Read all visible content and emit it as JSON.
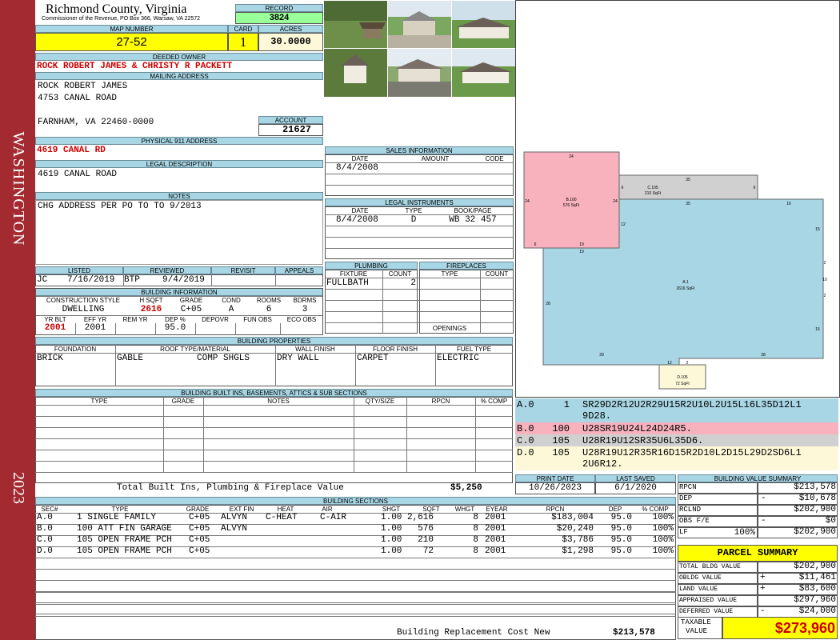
{
  "sidebar": {
    "label": "WASHINGTON",
    "year": "2023"
  },
  "header": {
    "county": "Richmond County, Virginia",
    "commissioner": "Commissioner of the Revenue, PO Box 366, Warsaw, VA 22572",
    "record_label": "RECORD",
    "record": "3824",
    "map_label": "MAP NUMBER",
    "map": "27-52",
    "card_label": "CARD",
    "card": "1",
    "acres_label": "ACRES",
    "acres": "30.0000"
  },
  "owner": {
    "deeded_label": "DEEDED OWNER",
    "deeded": "ROCK ROBERT JAMES & CHRISTY R PACKETT",
    "mailing_label": "MAILING ADDRESS",
    "mail1": "ROCK ROBERT JAMES",
    "mail2": "4753 CANAL ROAD",
    "mail3": "FARNHAM, VA 22460-0000",
    "account_label": "ACCOUNT",
    "account": "21627",
    "phys_label": "PHYSICAL 911 ADDRESS",
    "phys": "4619 CANAL RD",
    "legal_label": "LEGAL DESCRIPTION",
    "legal": "4619 CANAL ROAD",
    "notes_label": "NOTES",
    "notes": "CHG ADDRESS PER PO TO TO 9/2013"
  },
  "review": {
    "listed_label": "LISTED",
    "reviewed_label": "REVIEWED",
    "revisit_label": "REVISIT",
    "appeals_label": "APPEALS",
    "listed_by": "JC",
    "listed_date": "7/16/2019",
    "reviewed_by": "BTP",
    "reviewed_date": "9/4/2019"
  },
  "building_info": {
    "label": "BUILDING INFORMATION",
    "headers": [
      "CONSTRUCTION STYLE",
      "H SQFT",
      "GRADE",
      "COND",
      "ROOMS",
      "BDRMS"
    ],
    "style": "DWELLING",
    "hsqft": "2616",
    "grade": "C+05",
    "cond": "A",
    "rooms": "6",
    "bdrms": "3",
    "headers2": [
      "YR BLT",
      "EFF YR",
      "REM YR",
      "DEP %",
      "DEPOVR",
      "FUN OBS",
      "ECO OBS"
    ],
    "yrblt": "2001",
    "effyr": "2001",
    "dep": "95.0"
  },
  "props": {
    "label": "BUILDING PROPERTIES",
    "headers": [
      "FOUNDATION",
      "ROOF TYPE/MATERIAL",
      "WALL FINISH",
      "FLOOR FINISH",
      "FUEL TYPE"
    ],
    "foundation": "BRICK",
    "roof_type": "GABLE",
    "roof_mat": "COMP SHGLS",
    "wall": "DRY WALL",
    "floor": "CARPET",
    "fuel": "ELECTRIC"
  },
  "builtins": {
    "label": "BUILDING BUILT INS, BASEMENTS, ATTICS & SUB SECTIONS",
    "headers": [
      "TYPE",
      "GRADE",
      "NOTES",
      "QTY/SIZE",
      "RPCN",
      "% COMP"
    ],
    "total_label": "Total Built Ins, Plumbing & Fireplace Value",
    "total": "$5,250"
  },
  "sales": {
    "label": "SALES INFORMATION",
    "headers": [
      "DATE",
      "AMOUNT",
      "CODE"
    ],
    "date": "8/4/2008"
  },
  "legal_instr": {
    "label": "LEGAL INSTRUMENTS",
    "headers": [
      "DATE",
      "TYPE",
      "BOOK/PAGE"
    ],
    "date": "8/4/2008",
    "type": "D",
    "book": "WB 32 457"
  },
  "plumbing": {
    "label": "PLUMBING",
    "headers": [
      "FIXTURE",
      "COUNT"
    ],
    "fixture": "FULLBATH",
    "count": "2"
  },
  "fireplaces": {
    "label": "FIREPLACES",
    "headers": [
      "TYPE",
      "COUNT"
    ],
    "openings": "OPENINGS"
  },
  "sketch": {
    "labels": [
      {
        "code": "B.100",
        "area": "576 SqFt"
      },
      {
        "code": "C.105",
        "area": "210 SqFt"
      },
      {
        "code": "A.1",
        "area": "2616 SqFt"
      },
      {
        "code": "D.105",
        "area": "72 SqFt"
      }
    ],
    "dims": [
      "24",
      "24",
      "24",
      "6",
      "19",
      "19",
      "35",
      "35",
      "6",
      "16",
      "12",
      "15",
      "28",
      "2",
      "10",
      "2",
      "15",
      "29",
      "12",
      "2",
      "28",
      "6"
    ],
    "legend": [
      {
        "sec": "A.0",
        "num": "1",
        "text": "SR29D2R12U2R29U15R2U10L2U15L16L35D12L1",
        "text2": "9D28.",
        "color": "#a8d6e4"
      },
      {
        "sec": "B.0",
        "num": "100",
        "text": "U28SR19U24L24D24R5.",
        "color": "#f7b2bd"
      },
      {
        "sec": "C.0",
        "num": "105",
        "text": "U28R19U12SR35U6L35D6.",
        "color": "#d0d0d0"
      },
      {
        "sec": "D.0",
        "num": "105",
        "text": "U28R19U12R35R16D15R2D10L2D15L29D2SD6L1",
        "text2": "2U6R12.",
        "color": "#fdf8d8"
      }
    ],
    "colors": {
      "A": "#a8d6e4",
      "B": "#f7b2bd",
      "C": "#d0d0d0",
      "D": "#fdf8d8"
    }
  },
  "print": {
    "print_label": "PRINT DATE",
    "print": "10/26/2023",
    "saved_label": "LAST SAVED",
    "saved": "6/1/2020"
  },
  "sections": {
    "label": "BUILDING SECTIONS",
    "headers": [
      "SEC#",
      "TYPE",
      "GRADE",
      "EXT FIN",
      "HEAT",
      "AIR",
      "SHGT",
      "SQFT",
      "WHGT",
      "EYEAR",
      "RPCN",
      "DEP",
      "% COMP"
    ],
    "rows": [
      [
        "A.0",
        "1 SINGLE FAMILY",
        "C+05",
        "ALVYN",
        "C-HEAT",
        "C-AIR",
        "1.00",
        "2,616",
        "8",
        "2001",
        "$183,004",
        "95.0",
        "100%"
      ],
      [
        "B.0",
        "100 ATT FIN GARAGE",
        "C+05",
        "ALVYN",
        "",
        "",
        "1.00",
        "576",
        "8",
        "2001",
        "$20,240",
        "95.0",
        "100%"
      ],
      [
        "C.0",
        "105 OPEN FRAME PCH",
        "C+05",
        "",
        "",
        "",
        "1.00",
        "210",
        "8",
        "2001",
        "$3,786",
        "95.0",
        "100%"
      ],
      [
        "D.0",
        "105 OPEN FRAME PCH",
        "C+05",
        "",
        "",
        "",
        "1.00",
        "72",
        "8",
        "2001",
        "$1,298",
        "95.0",
        "100%"
      ]
    ],
    "rcn_label": "Building Replacement Cost New",
    "rcn": "$213,578"
  },
  "value_summary": {
    "label": "BUILDING VALUE SUMMARY",
    "rpcn_label": "RPCN",
    "rpcn": "$213,578",
    "dep_label": "DEP",
    "dep_sign": "-",
    "dep": "$10,678",
    "rclnd_label": "RCLND",
    "rclnd": "$202,900",
    "obs_label": "OBS F/E",
    "obs_sign": "-",
    "obs": "$0",
    "lf_label": "LF",
    "lf_pct": "100%",
    "lf": "$202,900"
  },
  "parcel": {
    "label": "PARCEL SUMMARY",
    "rows": [
      {
        "label": "TOTAL BLDG VALUE",
        "sign": "",
        "value": "$202,900"
      },
      {
        "label": "OBLDG VALUE",
        "sign": "+",
        "value": "$11,461"
      },
      {
        "label": "LAND VALUE",
        "sign": "+",
        "value": "$83,600"
      },
      {
        "label": "APPRAISED VALUE",
        "sign": "",
        "value": "$297,960"
      },
      {
        "label": "DEFERRED VALUE",
        "sign": "-",
        "value": "$24,000"
      }
    ],
    "taxable_label1": "TAXABLE",
    "taxable_label2": "VALUE",
    "taxable": "$273,960"
  },
  "photos": [
    "picnic-shelter-photo",
    "carport-photo",
    "house-photo",
    "gazebo-photo",
    "garage-photo",
    "house-side-photo"
  ]
}
